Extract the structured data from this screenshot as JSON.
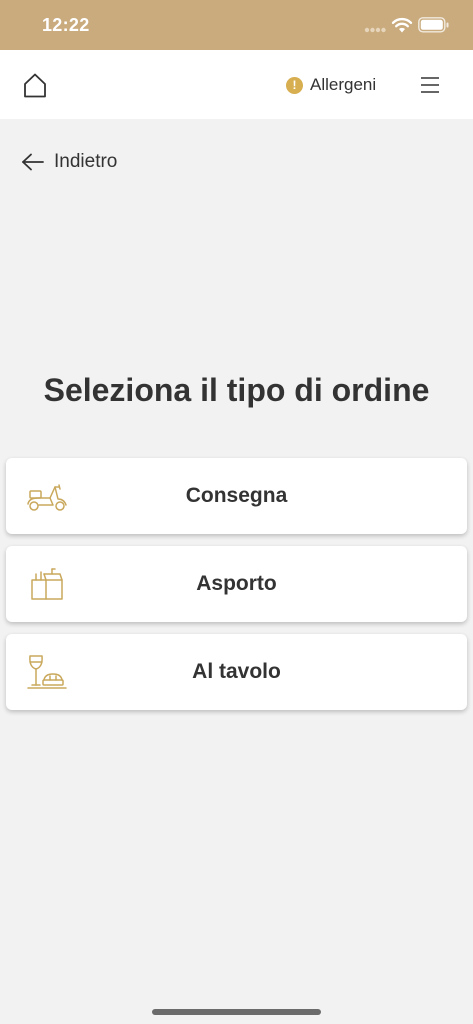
{
  "status_bar": {
    "time": "12:22"
  },
  "header": {
    "allergens_badge": "!",
    "allergens_label": "Allergeni"
  },
  "navigation": {
    "back_label": "Indietro"
  },
  "main": {
    "title": "Seleziona il tipo di ordine",
    "options": [
      {
        "label": "Consegna",
        "icon": "scooter-icon"
      },
      {
        "label": "Asporto",
        "icon": "takeaway-bag-icon"
      },
      {
        "label": "Al tavolo",
        "icon": "wine-table-icon"
      }
    ]
  },
  "colors": {
    "status_bar": "#c9ab7e",
    "accent_gold": "#d7ae50",
    "icon_gold": "#c9a85c",
    "background": "#f2f2f2",
    "text": "#333333"
  }
}
